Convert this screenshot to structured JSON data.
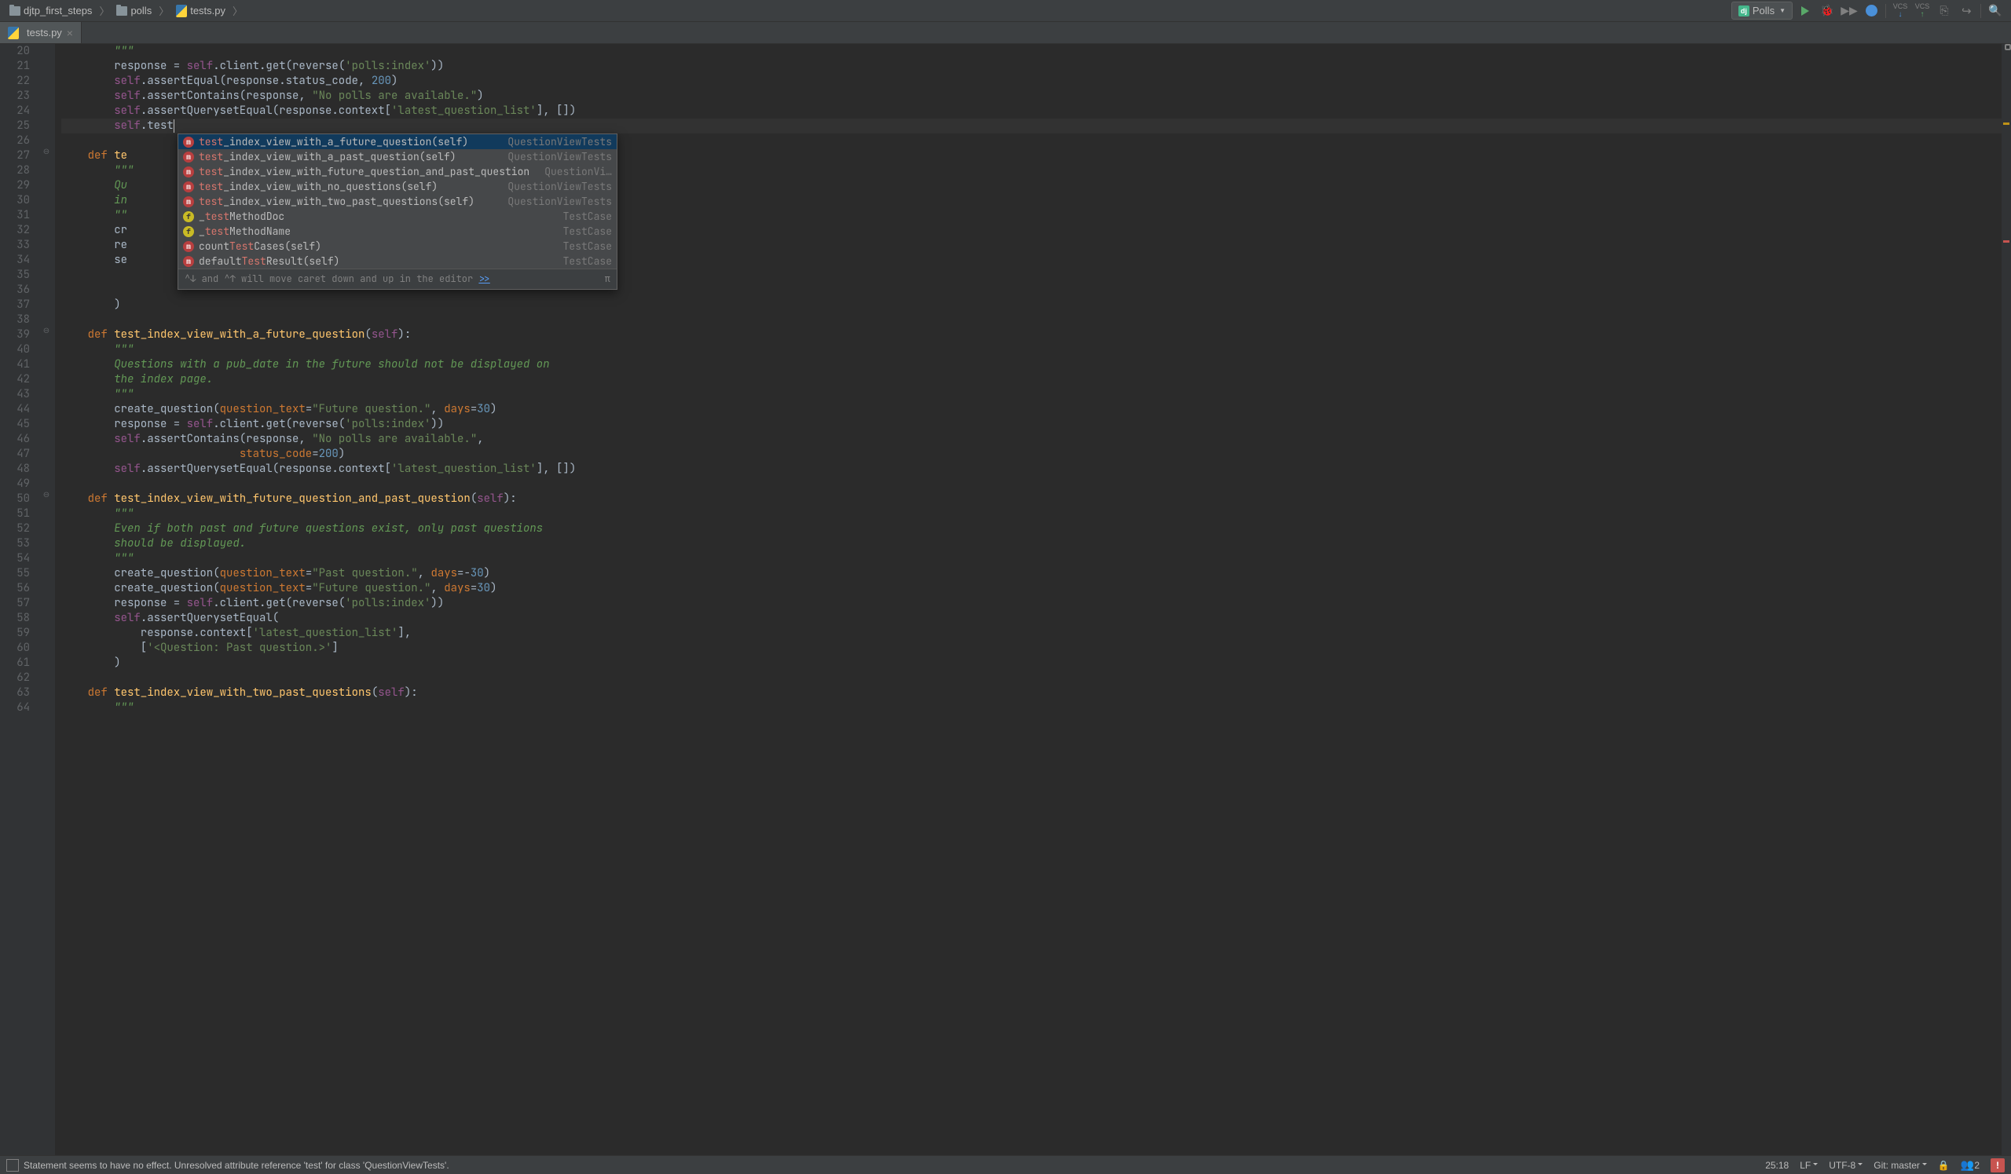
{
  "breadcrumb": {
    "root": "djtp_first_steps",
    "mid": "polls",
    "file": "tests.py"
  },
  "run_config": {
    "name": "Polls",
    "icon_text": "dj"
  },
  "vcs_labels": {
    "down": "VCS",
    "up": "VCS"
  },
  "tab": {
    "name": "tests.py"
  },
  "line_numbers": [
    20,
    21,
    22,
    23,
    24,
    25,
    26,
    27,
    28,
    29,
    30,
    31,
    32,
    33,
    34,
    35,
    36,
    37,
    38,
    39,
    40,
    41,
    42,
    43,
    44,
    45,
    46,
    47,
    48,
    49,
    50,
    51,
    52,
    53,
    54,
    55,
    56,
    57,
    58,
    59,
    60,
    61,
    62,
    63,
    64
  ],
  "code": {
    "l20": "        \"\"\"",
    "l21_a": "        response = ",
    "l21_self": "self",
    "l21_b": ".client.get(reverse(",
    "l21_str": "'polls:index'",
    "l21_c": "))",
    "l22_self": "        self",
    "l22_b": ".assertEqual(response.status_code, ",
    "l22_num": "200",
    "l22_c": ")",
    "l23_self": "        self",
    "l23_b": ".assertContains(response, ",
    "l23_str": "\"No polls are available.\"",
    "l23_c": ")",
    "l24_self": "        self",
    "l24_b": ".assertQuerysetEqual(response.context[",
    "l24_str": "'latest_question_list'",
    "l24_c": "], [])",
    "l25_self": "        self",
    "l25_b": ".test",
    "l26": "",
    "l27_def": "    def ",
    "l27_name": "te",
    "l28_a": "        ",
    "l28_doc": "\"\"\"",
    "l29_a": "        ",
    "l29_doc": "Qu",
    "l30_a": "        ",
    "l30_doc": "in",
    "l31_a": "        ",
    "l31_doc": "\"\"",
    "l32_a": "        cr",
    "l33_a": "        re",
    "l34_a": "        se",
    "l35_a": "",
    "l36_a": "",
    "l37_a": "        )",
    "l38": "",
    "l39_def": "    def ",
    "l39_name": "test_index_view_with_a_future_question",
    "l39_p": "(",
    "l39_self": "self",
    "l39_c": "):",
    "l40": "        \"\"\"",
    "l41": "        Questions with a pub_date in the future should not be displayed on",
    "l42": "        the index page.",
    "l43": "        \"\"\"",
    "l44_a": "        create_question(",
    "l44_p1": "question_text",
    "l44_b": "=",
    "l44_s1": "\"Future question.\"",
    "l44_c": ", ",
    "l44_p2": "days",
    "l44_d": "=",
    "l44_n": "30",
    "l44_e": ")",
    "l45_a": "        response = ",
    "l45_self": "self",
    "l45_b": ".client.get(reverse(",
    "l45_s": "'polls:index'",
    "l45_c": "))",
    "l46_self": "        self",
    "l46_b": ".assertContains(response, ",
    "l46_s": "\"No polls are available.\"",
    "l46_c": ",",
    "l47_a": "                           ",
    "l47_p": "status_code",
    "l47_b": "=",
    "l47_n": "200",
    "l47_c": ")",
    "l48_self": "        self",
    "l48_b": ".assertQuerysetEqual(response.context[",
    "l48_s": "'latest_question_list'",
    "l48_c": "], [])",
    "l49": "",
    "l50_def": "    def ",
    "l50_name": "test_index_view_with_future_question_and_past_question",
    "l50_p": "(",
    "l50_self": "self",
    "l50_c": "):",
    "l51": "        \"\"\"",
    "l52": "        Even if both past and future questions exist, only past questions",
    "l53": "        should be displayed.",
    "l54": "        \"\"\"",
    "l55_a": "        create_question(",
    "l55_p1": "question_text",
    "l55_b": "=",
    "l55_s1": "\"Past question.\"",
    "l55_c": ", ",
    "l55_p2": "days",
    "l55_d": "=-",
    "l55_n": "30",
    "l55_e": ")",
    "l56_a": "        create_question(",
    "l56_p1": "question_text",
    "l56_b": "=",
    "l56_s1": "\"Future question.\"",
    "l56_c": ", ",
    "l56_p2": "days",
    "l56_d": "=",
    "l56_n": "30",
    "l56_e": ")",
    "l57_a": "        response = ",
    "l57_self": "self",
    "l57_b": ".client.get(reverse(",
    "l57_s": "'polls:index'",
    "l57_c": "))",
    "l58_self": "        self",
    "l58_b": ".assertQuerysetEqual(",
    "l59_a": "            response.context[",
    "l59_s": "'latest_question_list'",
    "l59_b": "],",
    "l60_a": "            [",
    "l60_s": "'<Question: Past question.>'",
    "l60_b": "]",
    "l61_a": "        )",
    "l62": "",
    "l63_def": "    def ",
    "l63_name": "test_index_view_with_two_past_questions",
    "l63_p": "(",
    "l63_self": "self",
    "l63_c": "):",
    "l64": "        \"\"\""
  },
  "completion": {
    "items": [
      {
        "match": "test",
        "rest": "_index_view_with_a_future_question(self)",
        "source": "QuestionViewTests",
        "icon": "m",
        "selected": true
      },
      {
        "match": "test",
        "rest": "_index_view_with_a_past_question(self)",
        "source": "QuestionViewTests",
        "icon": "m"
      },
      {
        "match": "test",
        "rest": "_index_view_with_future_question_and_past_question",
        "source": "QuestionVi…",
        "icon": "m"
      },
      {
        "match": "test",
        "rest": "_index_view_with_no_questions(self)",
        "source": "QuestionViewTests",
        "icon": "m"
      },
      {
        "match": "test",
        "rest": "_index_view_with_two_past_questions(self)",
        "source": "QuestionViewTests",
        "icon": "m"
      },
      {
        "pre": "_",
        "match": "test",
        "rest": "MethodDoc",
        "source": "TestCase",
        "icon": "f"
      },
      {
        "pre": "_",
        "match": "test",
        "rest": "MethodName",
        "source": "TestCase",
        "icon": "f"
      },
      {
        "pre": "count",
        "match": "Test",
        "rest": "Cases(self)",
        "source": "TestCase",
        "icon": "m"
      },
      {
        "pre": "default",
        "match": "Test",
        "rest": "Result(self)",
        "source": "TestCase",
        "icon": "m"
      }
    ],
    "footer_hint": "^↓ and ^↑ will move caret down and up in the editor  ",
    "footer_link": ">>",
    "pi": "π"
  },
  "status": {
    "message": "Statement seems to have no effect. Unresolved attribute reference 'test' for class 'QuestionViewTests'.",
    "cursor": "25:18",
    "line_sep": "LF",
    "encoding": "UTF-8",
    "branch": "Git: master",
    "man_count": "2"
  }
}
